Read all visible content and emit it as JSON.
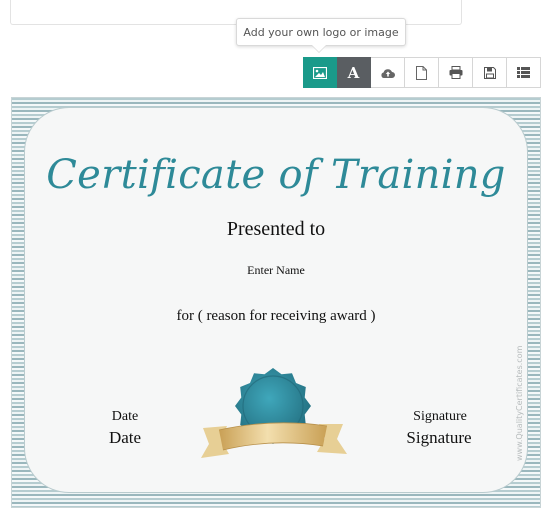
{
  "tooltip": {
    "text": "Add your own logo or image"
  },
  "toolbar": {
    "buttons": [
      {
        "name": "add-image",
        "icon": "image-icon"
      },
      {
        "name": "text",
        "icon": "text-icon",
        "letter": "A"
      },
      {
        "name": "cloud-upload",
        "icon": "cloud-upload-icon"
      },
      {
        "name": "new-document",
        "icon": "document-icon"
      },
      {
        "name": "print",
        "icon": "printer-icon"
      },
      {
        "name": "save",
        "icon": "floppy-disk-icon"
      },
      {
        "name": "list",
        "icon": "list-icon"
      }
    ]
  },
  "certificate": {
    "title": "Certificate of Training",
    "presented_to": "Presented to",
    "name_placeholder": "Enter Name",
    "reason": "for ( reason for receiving award )",
    "date_label": "Date",
    "date_value": "Date",
    "signature_label": "Signature",
    "signature_value": "Signature",
    "watermark": "www.QualityCertificates.com"
  },
  "colors": {
    "title": "#2e8a98",
    "accent_teal": "#1a9a8a",
    "dark_button": "#5a5e62",
    "seal": "#2d8fa3",
    "ribbon": "#d9b56a"
  }
}
